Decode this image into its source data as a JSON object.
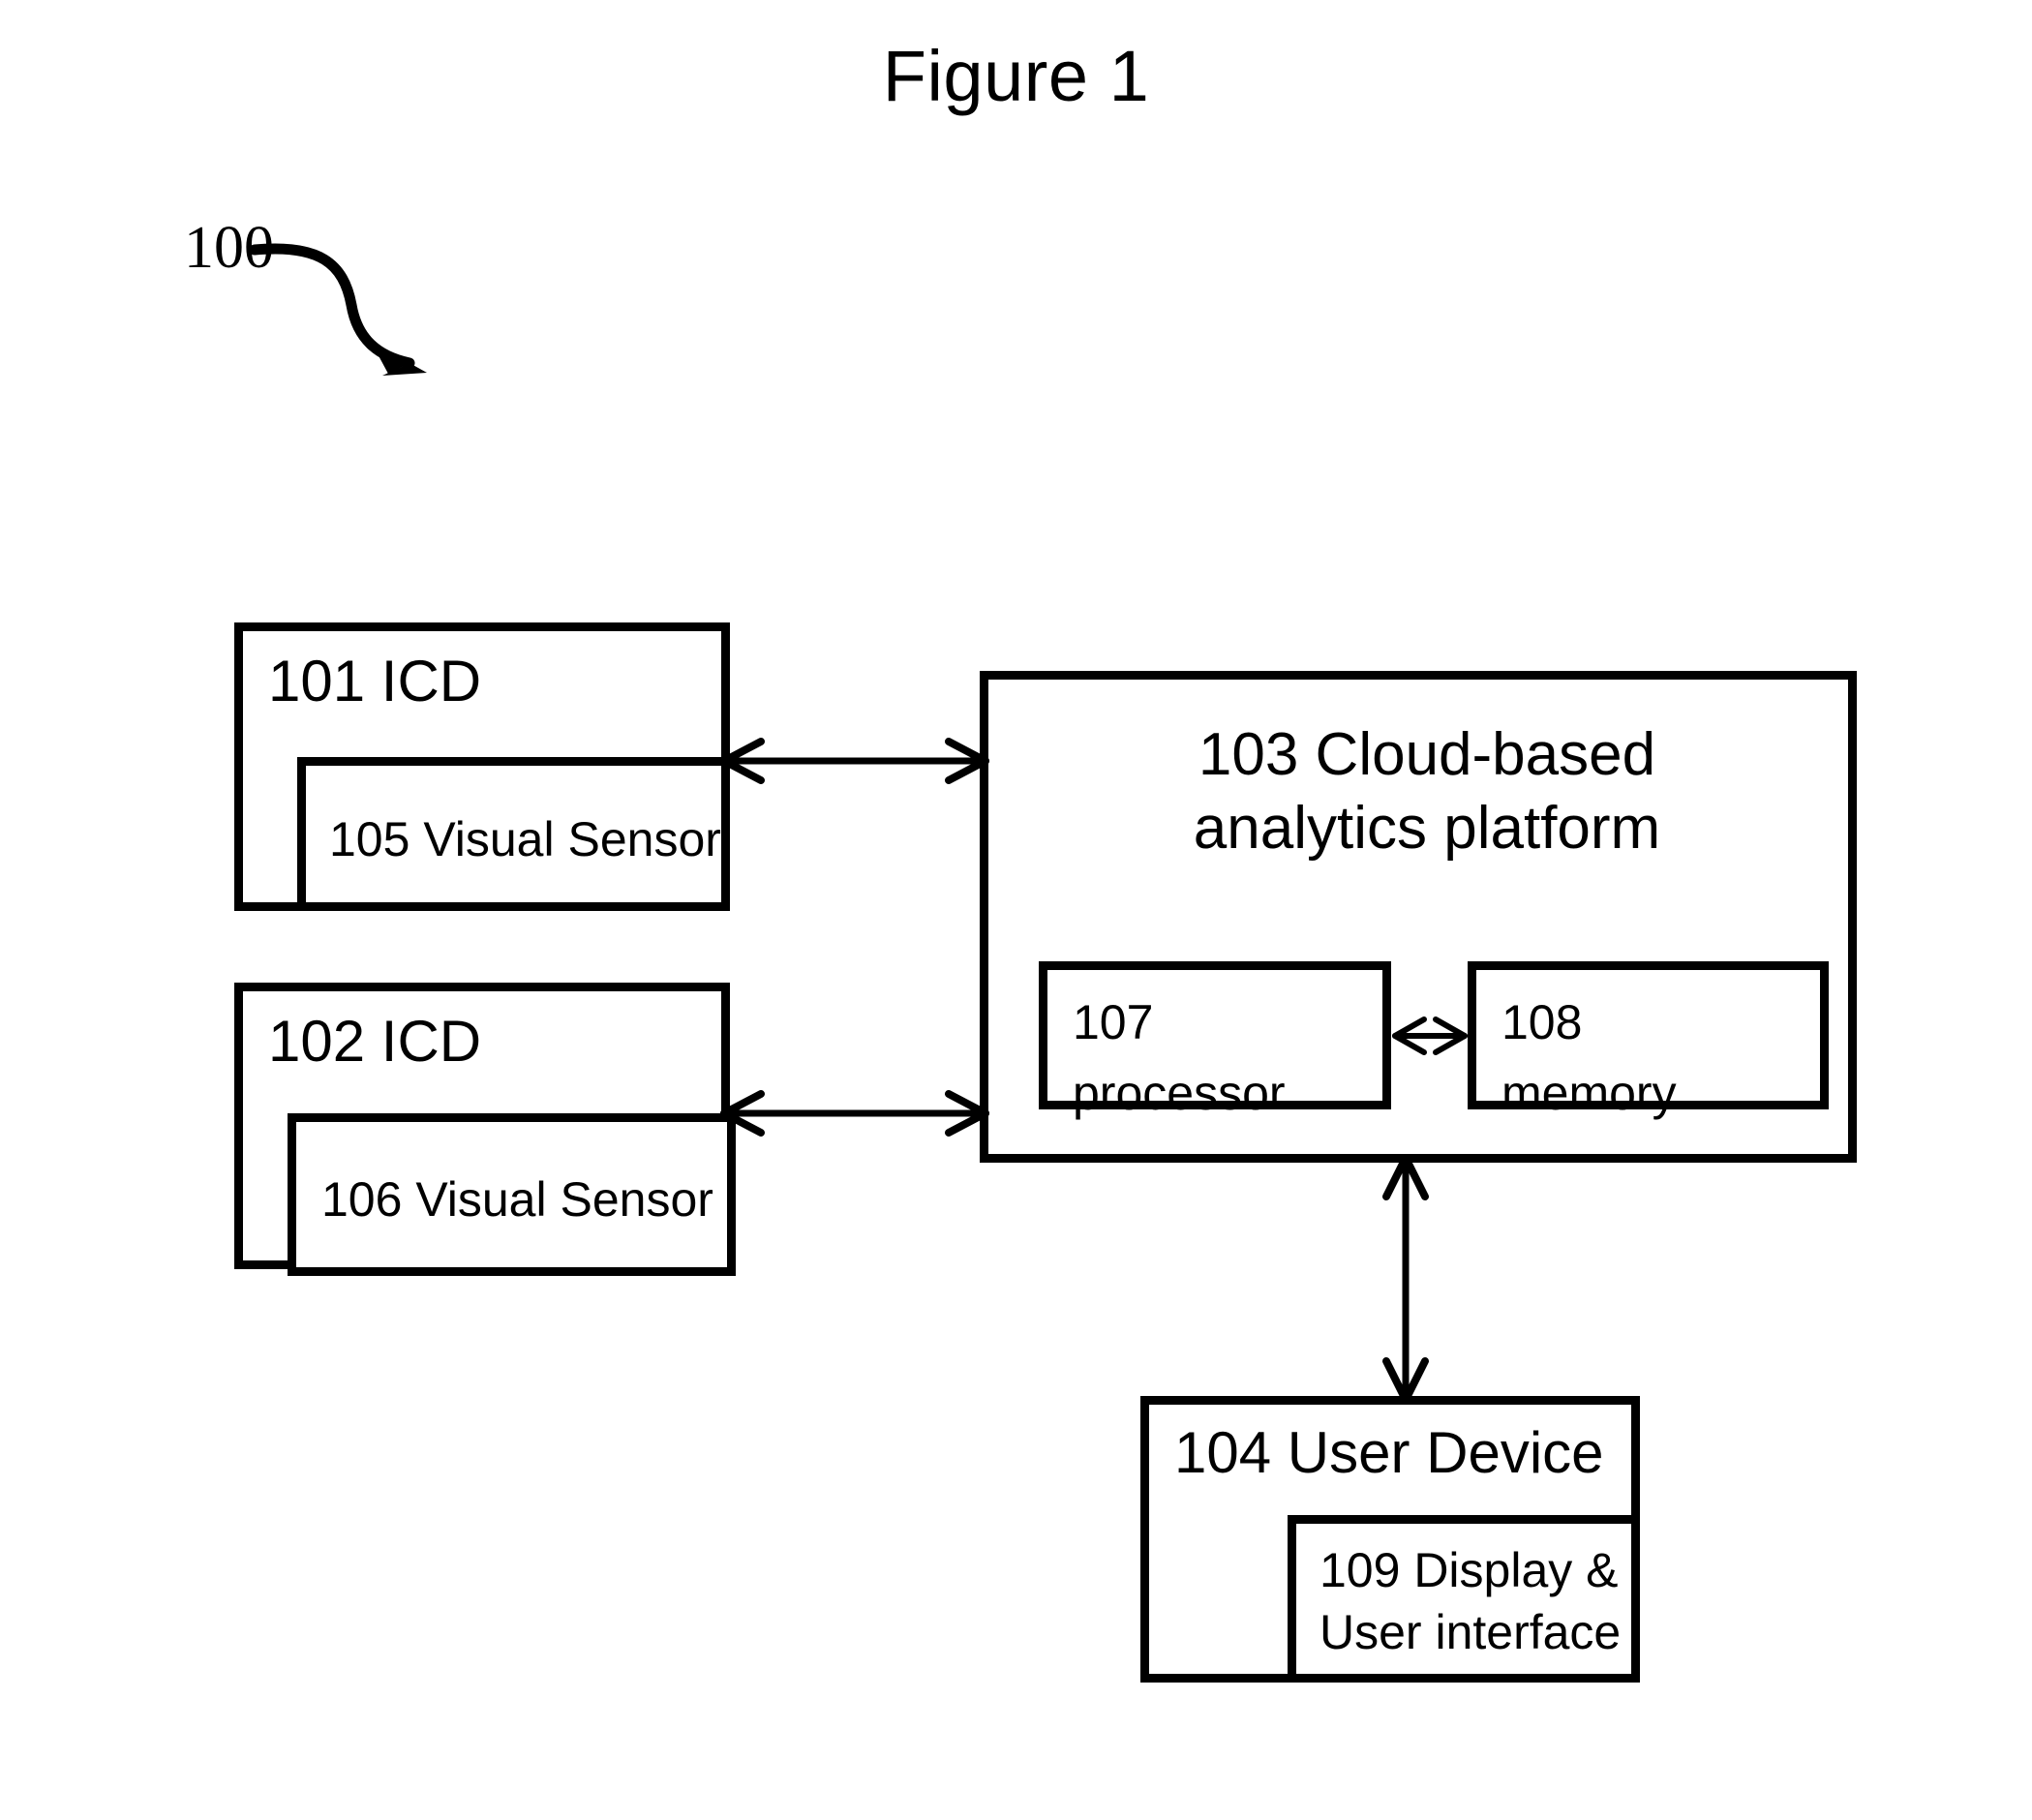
{
  "figure": {
    "title": "Figure 1",
    "system_reference": "100"
  },
  "blocks": {
    "icd_1": {
      "label": "101 ICD",
      "sensor": {
        "label": "105 Visual Sensor"
      }
    },
    "icd_2": {
      "label": "102 ICD",
      "sensor": {
        "label": "106 Visual Sensor"
      }
    },
    "platform": {
      "label_line1": "103 Cloud-based",
      "label_line2": "analytics platform",
      "processor": {
        "label_line1": "107",
        "label_line2": "processor"
      },
      "memory": {
        "label_line1": "108",
        "label_line2": "memory"
      }
    },
    "user_device": {
      "label": "104 User Device",
      "display": {
        "label_line1": "109 Display &",
        "label_line2": "User interface"
      }
    }
  },
  "connectors": {
    "icd1_to_platform": "bidirectional",
    "icd2_to_platform": "bidirectional",
    "processor_to_memory": "bidirectional",
    "platform_to_user_device": "bidirectional"
  },
  "colors": {
    "stroke": "#000000",
    "background": "#ffffff"
  }
}
